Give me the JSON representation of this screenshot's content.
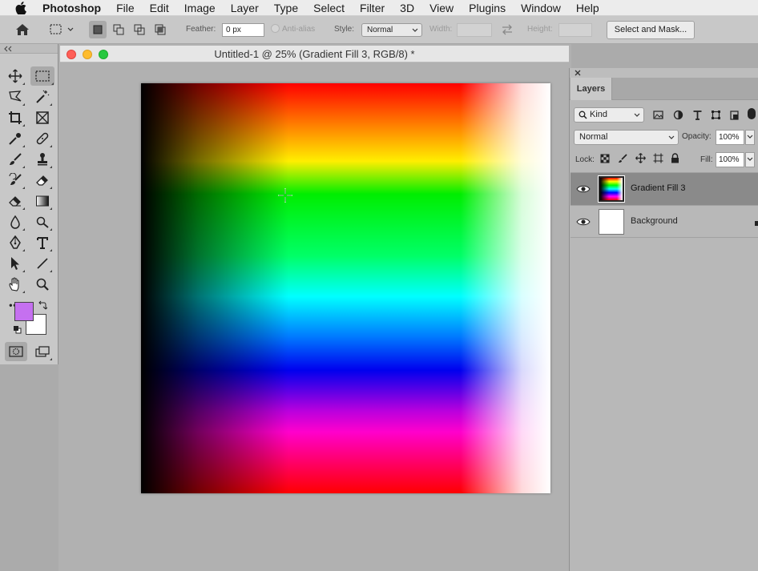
{
  "menubar": {
    "app_name": "Photoshop",
    "items": [
      "File",
      "Edit",
      "Image",
      "Layer",
      "Type",
      "Select",
      "Filter",
      "3D",
      "View",
      "Plugins",
      "Window",
      "Help"
    ]
  },
  "options_bar": {
    "feather_label": "Feather:",
    "feather_value": "0 px",
    "antialias_label": "Anti-alias",
    "style_label": "Style:",
    "style_value": "Normal",
    "width_label": "Width:",
    "height_label": "Height:",
    "select_and_mask_label": "Select and Mask..."
  },
  "document": {
    "title": "Untitled-1 @ 25% (Gradient Fill 3, RGB/8) *"
  },
  "toolbox": {
    "more_tools_glyph": "•••",
    "foreground_color": "#c570f0",
    "background_color": "#ffffff"
  },
  "layers_panel": {
    "tab_label": "Layers",
    "filter_value": "Kind",
    "blend_mode": "Normal",
    "opacity_label": "Opacity:",
    "opacity_value": "100%",
    "lock_label": "Lock:",
    "fill_label": "Fill:",
    "fill_value": "100%",
    "layers": [
      {
        "name": "Gradient Fill 3",
        "selected": true
      },
      {
        "name": "Background",
        "selected": false
      }
    ]
  },
  "colors": {
    "traffic_close": "#ff5f57",
    "traffic_min": "#febc2e",
    "traffic_max": "#28c840",
    "workspace": "#b1b1b1",
    "panel": "#b8b8b8"
  }
}
